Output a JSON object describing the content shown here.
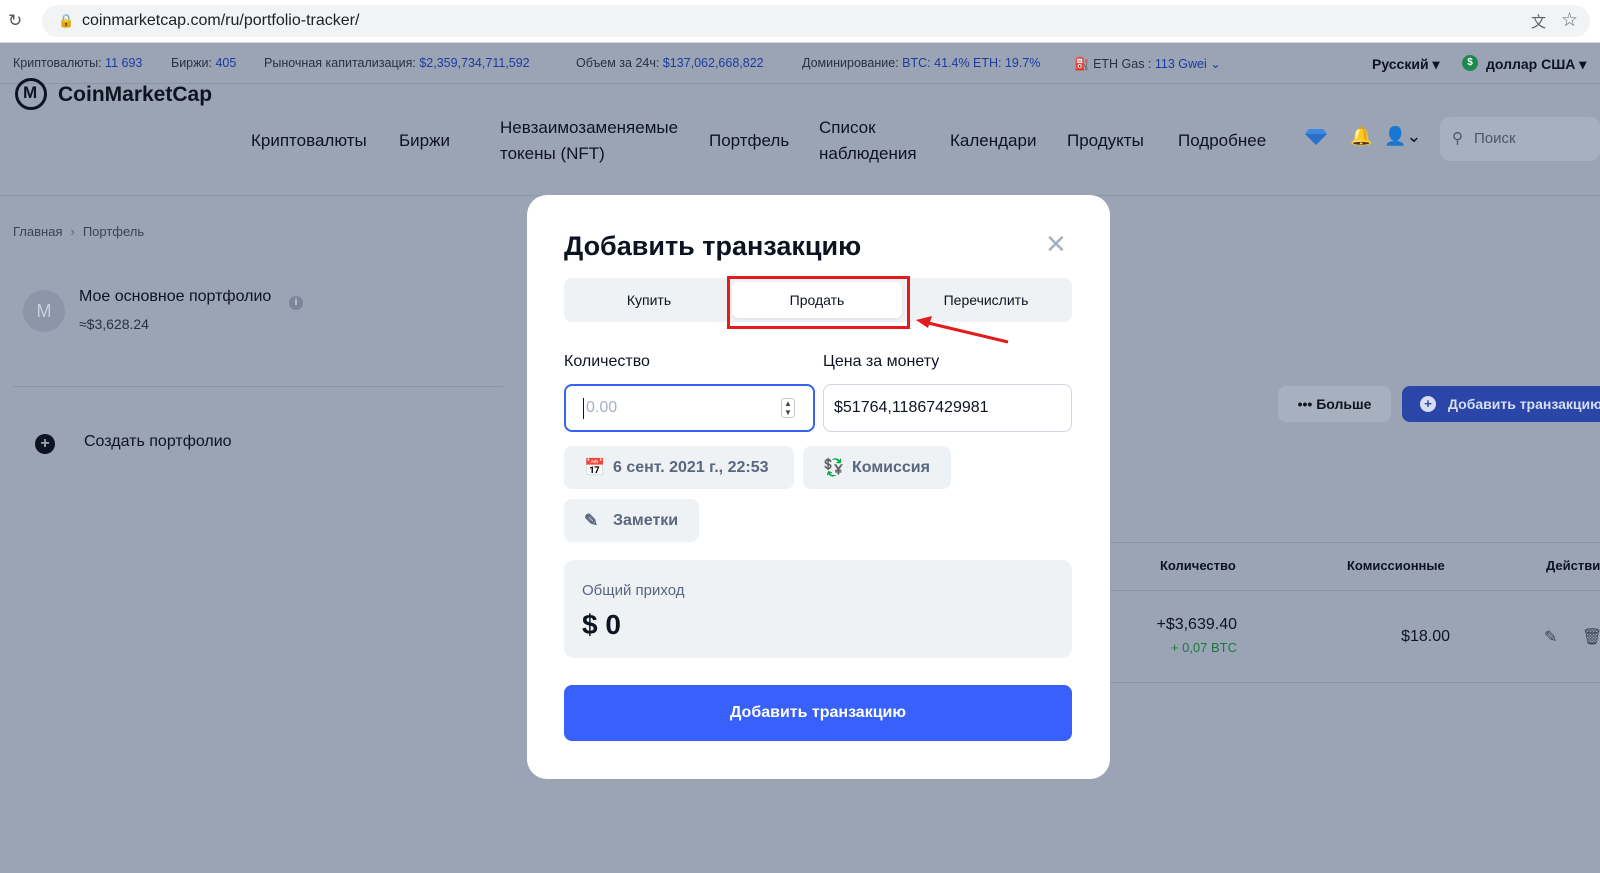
{
  "browser": {
    "url": "coinmarketcap.com/ru/portfolio-tracker/"
  },
  "stats": {
    "cryptos_label": "Криптовалюты:",
    "cryptos_value": "11 693",
    "exchanges_label": "Биржи:",
    "exchanges_value": "405",
    "market_cap_label": "Рыночная капитализация:",
    "market_cap_value": "$2,359,734,711,592",
    "volume_label": "Объем за 24ч:",
    "volume_value": "$137,062,668,822",
    "dominance_label": "Доминирование:",
    "dominance_value": "BTC: 41.4% ETH: 19.7%",
    "gas_label": "ETH Gas :",
    "gas_value": "113 Gwei",
    "language": "Русский",
    "currency": "доллар США"
  },
  "nav": {
    "logo": "CoinMarketCap",
    "items": [
      {
        "label": "Криптовалюты"
      },
      {
        "label": "Биржи"
      },
      {
        "label": "Невзаимозаменяемые токены (NFT)"
      },
      {
        "label": "Портфель"
      },
      {
        "label": "Список наблюдения"
      },
      {
        "label": "Календари"
      },
      {
        "label": "Продукты"
      },
      {
        "label": "Подробнее"
      }
    ],
    "search_placeholder": "Поиск"
  },
  "breadcrumb": {
    "home": "Главная",
    "current": "Портфель"
  },
  "portfolio": {
    "avatar_letter": "M",
    "name": "Мое основное портфолио",
    "value": "≈$3,628.24",
    "create_label": "Создать портфолио"
  },
  "actions": {
    "more_label": "Больше",
    "add_label": "Добавить транзакцию"
  },
  "table": {
    "headers": [
      "Количество",
      "Комиссионные",
      "Действи"
    ],
    "row": {
      "amount": "+$3,639.40",
      "amount_coin": "+ 0,07 BTC",
      "fee": "$18.00"
    }
  },
  "modal": {
    "title": "Добавить транзакцию",
    "tabs": [
      {
        "label": "Купить"
      },
      {
        "label": "Продать"
      },
      {
        "label": "Перечислить"
      }
    ],
    "active_tab": "Продать",
    "quantity_label": "Количество",
    "quantity_placeholder": "0.00",
    "price_label": "Цена за монету",
    "price_value": "$51764,11867429981",
    "date_label": "6 сент. 2021 г., 22:53",
    "fee_label": "Комиссия",
    "notes_label": "Заметки",
    "total_label": "Общий приход",
    "total_value": "$ 0",
    "submit_label": "Добавить транзакцию"
  },
  "colors": {
    "accent": "#3861fb",
    "highlight": "#e21b1b",
    "overlay": "#9aa4b5"
  }
}
